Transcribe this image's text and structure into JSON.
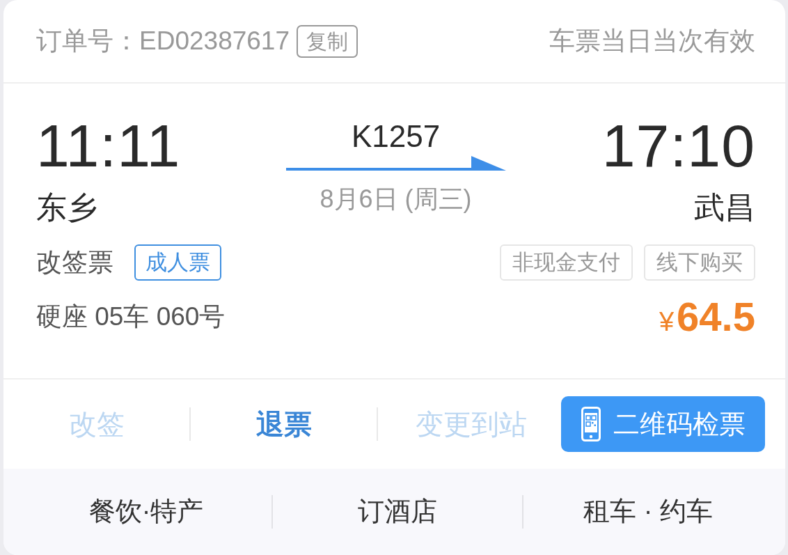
{
  "header": {
    "order_number": "订单号：ED02387617",
    "copy_button": "复制",
    "validity": "车票当日当次有效"
  },
  "trip": {
    "departure": {
      "time": "11:11",
      "station": "东乡"
    },
    "train": "K1257",
    "date": "8月6日 (周三)",
    "arrival": {
      "time": "17:10",
      "station": "武昌"
    }
  },
  "ticket": {
    "type": "改签票",
    "passenger_tag": "成人票",
    "payment_tags": [
      "非现金支付",
      "线下购买"
    ],
    "seat": "硬座 05车 060号",
    "price": {
      "currency": "¥",
      "amount": "64.5"
    }
  },
  "actions": [
    {
      "label": "改签",
      "kind": "text",
      "disabled": true
    },
    {
      "label": "退票",
      "kind": "text",
      "disabled": false
    },
    {
      "label": "变更到站",
      "kind": "text",
      "disabled": true
    },
    {
      "label": "二维码检票",
      "kind": "primary",
      "disabled": false
    }
  ],
  "services": [
    "餐饮·特产",
    "订酒店",
    "租车 · 约车"
  ]
}
